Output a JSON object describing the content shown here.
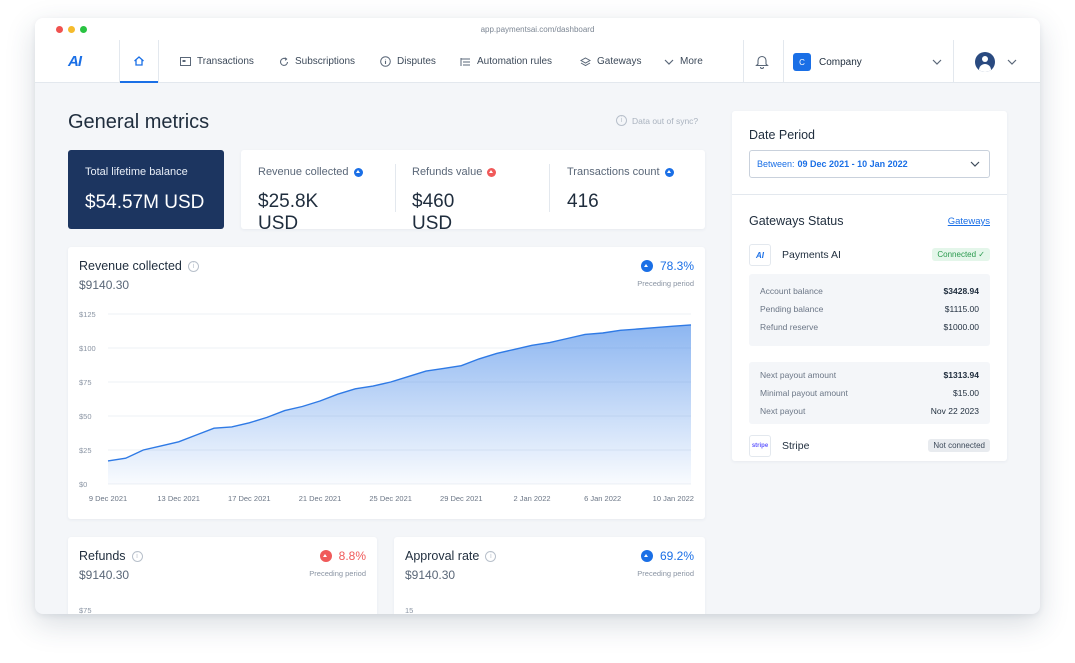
{
  "browser": {
    "url": "app.paymentsai.com/dashboard"
  },
  "nav": {
    "logo": "AI",
    "items": [
      {
        "label": "Transactions",
        "icon": "transactions-icon"
      },
      {
        "label": "Subscriptions",
        "icon": "refresh-icon"
      },
      {
        "label": "Disputes",
        "icon": "info-icon"
      },
      {
        "label": "Automation rules",
        "icon": "rules-icon"
      },
      {
        "label": "Gateways",
        "icon": "layers-icon"
      },
      {
        "label": "More",
        "icon": "chevron-down-icon"
      }
    ],
    "company_badge": "C",
    "company": "Company"
  },
  "page": {
    "title": "General metrics",
    "sync_note": "Data out of sync?"
  },
  "metrics": {
    "balance": {
      "label": "Total lifetime balance",
      "value": "$54.57M USD"
    },
    "revenue": {
      "label": "Revenue collected",
      "value": "$25.8K USD"
    },
    "refunds": {
      "label": "Refunds value",
      "value": "$460 USD"
    },
    "transactions": {
      "label": "Transactions count",
      "value": "416"
    }
  },
  "revenue_card": {
    "title": "Revenue collected",
    "value": "$9140.30",
    "change": "78.3%",
    "change_label": "Preceding period"
  },
  "chart_data": {
    "type": "area",
    "x": [
      "9 Dec 2021",
      "10 Dec 2021",
      "11 Dec 2021",
      "12 Dec 2021",
      "13 Dec 2021",
      "14 Dec 2021",
      "15 Dec 2021",
      "16 Dec 2021",
      "17 Dec 2021",
      "18 Dec 2021",
      "19 Dec 2021",
      "20 Dec 2021",
      "21 Dec 2021",
      "22 Dec 2021",
      "23 Dec 2021",
      "24 Dec 2021",
      "25 Dec 2021",
      "26 Dec 2021",
      "27 Dec 2021",
      "28 Dec 2021",
      "29 Dec 2021",
      "30 Dec 2021",
      "31 Dec 2021",
      "1 Jan 2022",
      "2 Jan 2022",
      "3 Jan 2022",
      "4 Jan 2022",
      "5 Jan 2022",
      "6 Jan 2022",
      "7 Jan 2022",
      "8 Jan 2022",
      "9 Jan 2022",
      "10 Jan 2022",
      "11 Jan 2022"
    ],
    "values": [
      17,
      19,
      25,
      28,
      31,
      36,
      41,
      42,
      45,
      49,
      54,
      57,
      61,
      66,
      70,
      72,
      75,
      79,
      83,
      85,
      87,
      92,
      96,
      99,
      102,
      104,
      107,
      110,
      111,
      113,
      114,
      115,
      116,
      117
    ],
    "tick_labels": [
      "9 Dec 2021",
      "13 Dec 2021",
      "17 Dec 2021",
      "21 Dec 2021",
      "25 Dec 2021",
      "29 Dec 2021",
      "2 Jan 2022",
      "6 Jan 2022",
      "10 Jan 2022"
    ],
    "tick_index": [
      0,
      4,
      8,
      12,
      16,
      20,
      24,
      28,
      32
    ],
    "y_ticks": [
      "$0",
      "$25",
      "$50",
      "$75",
      "$100",
      "$125"
    ],
    "ylim": [
      0,
      125
    ],
    "grid": true,
    "color": "#2f7ae5"
  },
  "refunds_card": {
    "title": "Refunds",
    "value": "$9140.30",
    "change": "8.8%",
    "change_label": "Preceding period",
    "tick": "$75"
  },
  "approval_card": {
    "title": "Approval rate",
    "value": "$9140.30",
    "change": "69.2%",
    "change_label": "Preceding period",
    "tick": "15"
  },
  "date_period": {
    "title": "Date Period",
    "prefix": "Between:",
    "range": "09 Dec 2021 - 10 Jan 2022"
  },
  "gateways": {
    "title": "Gateways Status",
    "link": "Gateways",
    "payments_ai": {
      "logo": "AI",
      "name": "Payments AI",
      "status": "Connected ✓",
      "account_balance": {
        "label": "Account balance",
        "value": "$3428.94"
      },
      "pending_balance": {
        "label": "Pending balance",
        "value": "$1115.00"
      },
      "refund_reserve": {
        "label": "Refund reserve",
        "value": "$1000.00"
      },
      "next_payout_amount": {
        "label": "Next payout amount",
        "value": "$1313.94"
      },
      "minimal_payout_amount": {
        "label": "Minimal payout amount",
        "value": "$15.00"
      },
      "next_payout": {
        "label": "Next payout",
        "value": "Nov 22 2023"
      }
    },
    "stripe": {
      "logo": "stripe",
      "name": "Stripe",
      "status": "Not connected"
    }
  },
  "colors": {
    "accent": "#1a6fe6",
    "navy": "#1c3560",
    "positive_up": "#1a6fe6",
    "negative_up": "#f05a5a",
    "connected": "#2a9a4e"
  }
}
